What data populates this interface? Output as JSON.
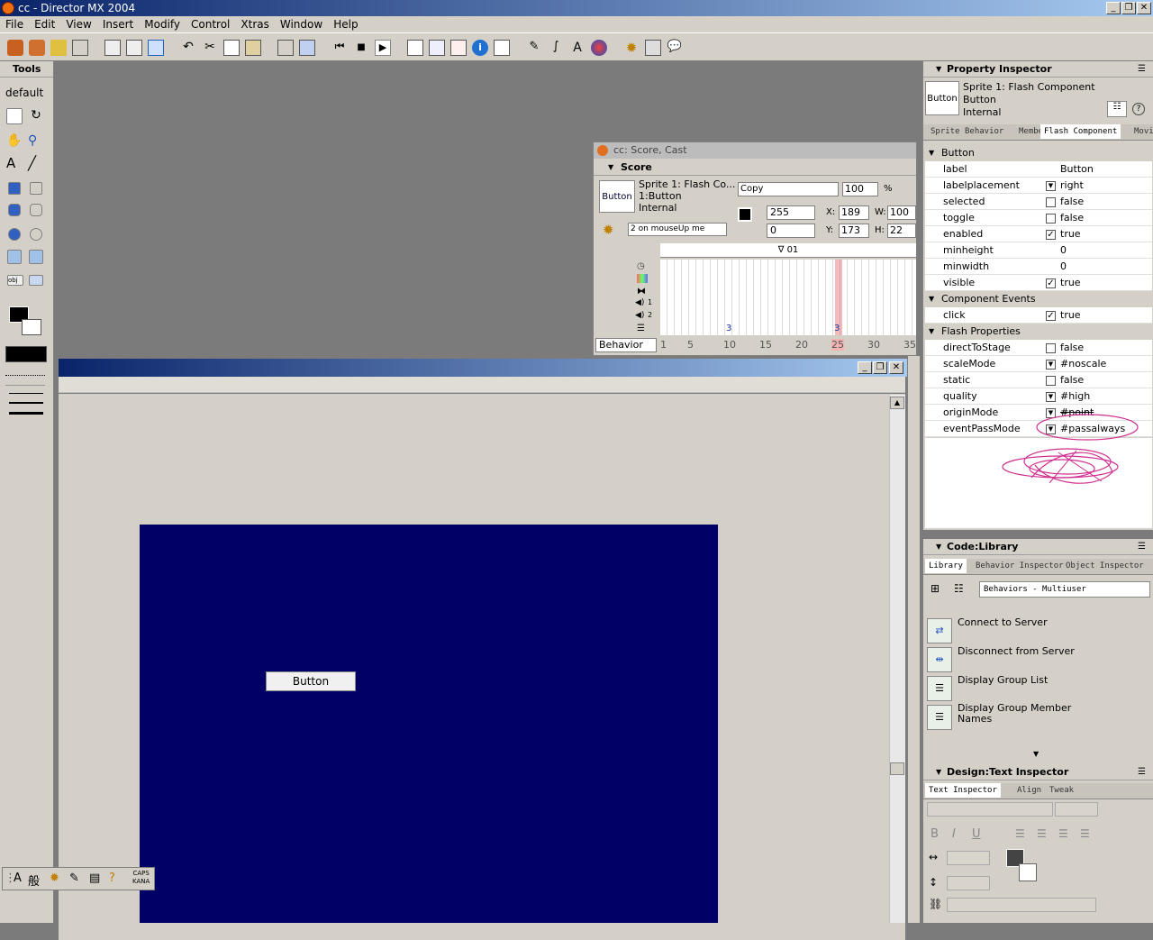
{
  "window": {
    "title": "cc - Director MX 2004",
    "controls": [
      "_",
      "❐",
      "✕"
    ]
  },
  "menu": [
    "File",
    "Edit",
    "View",
    "Insert",
    "Modify",
    "Control",
    "Xtras",
    "Window",
    "Help"
  ],
  "tools_panel": {
    "title": "Tools",
    "preset": "default"
  },
  "score": {
    "title": "cc: Score, Cast",
    "panel": "Score",
    "sprite_line1": "Sprite 1: Flash Co...",
    "sprite_line2": "1:Button",
    "sprite_line3": "Internal",
    "thumb_label": "Button",
    "ink": "Copy",
    "blend": "100",
    "blend_unit": "%",
    "behavior_script": "2 on mouseUp me",
    "fore_value": "255",
    "back_value": "0",
    "x_label": "X:",
    "x_value": "189",
    "y_label": "Y:",
    "y_value": "173",
    "w_label": "W:",
    "w_value": "100",
    "h_label": "H:",
    "h_value": "22",
    "marker": "∇ 01",
    "channel_labels": [
      "1",
      "2"
    ],
    "cell_marks": [
      "3",
      "3"
    ],
    "channel_select": "Behavior",
    "frame_numbers": [
      "1",
      "5",
      "10",
      "15",
      "20",
      "25",
      "30",
      "35"
    ]
  },
  "stage": {
    "button_label": "Button"
  },
  "property_inspector": {
    "title": "Property Inspector",
    "sprite_line1": "Sprite 1: Flash Component",
    "sprite_line2": "Button",
    "sprite_line3": "Internal",
    "thumb_label": "Button",
    "tabs": [
      "Sprite",
      "Behavior",
      "Member",
      "Flash Component",
      "Movie"
    ],
    "sections": [
      {
        "name": "Button",
        "rows": [
          {
            "name": "label",
            "value": "Button"
          },
          {
            "name": "labelplacement",
            "value": "right",
            "control": "dropdown"
          },
          {
            "name": "selected",
            "value": "false",
            "control": "checkbox",
            "checked": false
          },
          {
            "name": "toggle",
            "value": "false",
            "control": "checkbox",
            "checked": false
          },
          {
            "name": "enabled",
            "value": "true",
            "control": "checkbox",
            "checked": true
          },
          {
            "name": "minheight",
            "value": "0"
          },
          {
            "name": "minwidth",
            "value": "0"
          },
          {
            "name": "visible",
            "value": "true",
            "control": "checkbox",
            "checked": true
          }
        ]
      },
      {
        "name": "Component Events",
        "rows": [
          {
            "name": "click",
            "value": "true",
            "control": "checkbox",
            "checked": true
          }
        ]
      },
      {
        "name": "Flash Properties",
        "rows": [
          {
            "name": "directToStage",
            "value": "false",
            "control": "checkbox",
            "checked": false
          },
          {
            "name": "scaleMode",
            "value": "#noscale",
            "control": "dropdown"
          },
          {
            "name": "static",
            "value": "false",
            "control": "checkbox",
            "checked": false
          },
          {
            "name": "quality",
            "value": "#high",
            "control": "dropdown"
          },
          {
            "name": "originMode",
            "value": "#point",
            "control": "dropdown"
          },
          {
            "name": "eventPassMode",
            "value": "#passalways",
            "control": "dropdown"
          }
        ]
      }
    ]
  },
  "library": {
    "title": "Code:Library",
    "tabs": [
      "Library",
      "Behavior Inspector",
      "Object Inspector"
    ],
    "category": "Behaviors - Multiuser",
    "items": [
      "Connect to Server",
      "Disconnect from Server",
      "Display Group List",
      "Display Group Member Names"
    ]
  },
  "text_inspector": {
    "title": "Design:Text Inspector",
    "tabs": [
      "Text Inspector",
      "Align",
      "Tweak"
    ],
    "bold": "B",
    "italic": "I",
    "underline": "U"
  },
  "ime": {
    "a": "A",
    "han": "般",
    "caps": "CAPS",
    "kana": "KANA"
  },
  "colors": {
    "stage": "#000066",
    "title_start": "#0a246a",
    "title_end": "#a6caf0",
    "annotation": "#d0308f"
  }
}
